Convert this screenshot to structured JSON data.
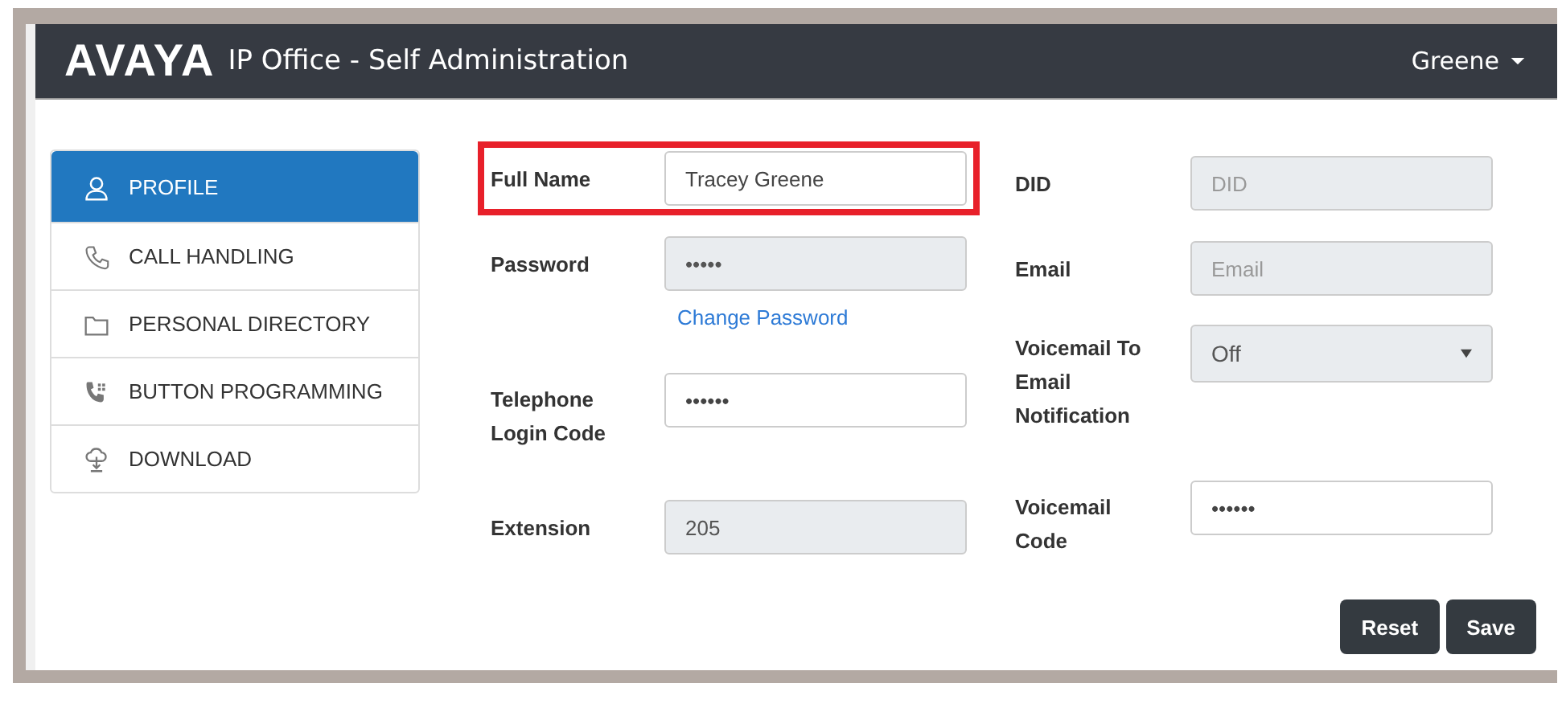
{
  "header": {
    "logo": "AVAYA",
    "title": "IP Office - Self Administration",
    "user": "Greene"
  },
  "sidebar": {
    "items": [
      {
        "label": "PROFILE",
        "selected": true
      },
      {
        "label": "CALL HANDLING",
        "selected": false
      },
      {
        "label": "PERSONAL DIRECTORY",
        "selected": false
      },
      {
        "label": "BUTTON PROGRAMMING",
        "selected": false
      },
      {
        "label": "DOWNLOAD",
        "selected": false
      }
    ]
  },
  "form": {
    "left": [
      {
        "label": "Full Name",
        "kind": "text",
        "value": "Tracey Greene",
        "disabled": false,
        "highlighted": true
      },
      {
        "label": "Password",
        "kind": "text",
        "value": "•••••",
        "disabled": true,
        "highlighted": false,
        "link": "Change Password"
      },
      {
        "label": "Telephone Login Code",
        "kind": "text",
        "value": "••••••",
        "disabled": false,
        "highlighted": false
      },
      {
        "label": "Extension",
        "kind": "text",
        "value": "205",
        "disabled": true,
        "highlighted": false
      }
    ],
    "right": [
      {
        "label": "DID",
        "kind": "text",
        "placeholder": "DID",
        "disabled": true,
        "highlighted": false
      },
      {
        "label": "Email",
        "kind": "text",
        "placeholder": "Email",
        "disabled": true,
        "highlighted": false
      },
      {
        "label": "Voicemail To Email Notification",
        "kind": "select",
        "value": "Off",
        "disabled": true,
        "highlighted": false
      },
      {
        "label": "Voicemail Code",
        "kind": "text",
        "value": "••••••",
        "disabled": false,
        "highlighted": false
      }
    ]
  },
  "buttons": [
    "Reset",
    "Save"
  ]
}
